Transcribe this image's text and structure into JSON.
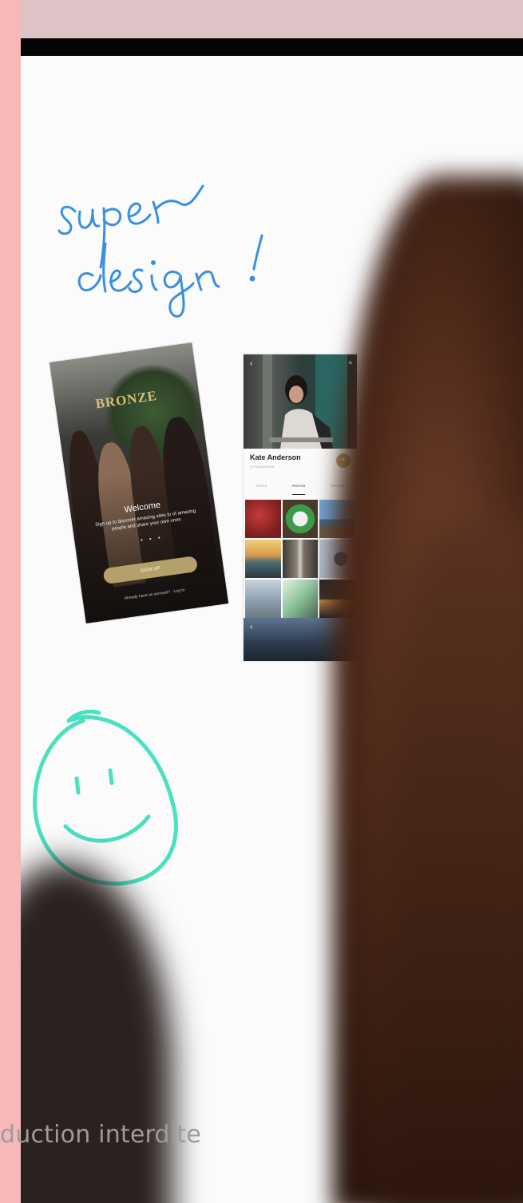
{
  "handwriting": {
    "line1": "super",
    "line2": "design!"
  },
  "phone_login": {
    "brand": "BRONZE",
    "welcome": "Welcome",
    "subtitle": "Sign up to discover amazing sites to of amazing people and share your own ones",
    "signup_button": "SIGN UP",
    "login_note": "Already have an account? · Log In"
  },
  "phone_profile": {
    "name": "Kate Anderson",
    "subtitle": "CITY/LOCATION",
    "tabs": [
      "POSTS",
      "PHOTOS",
      "FRIENDS"
    ],
    "active_tab": "PHOTOS",
    "add_button": "+"
  },
  "watermark": "duction interdite",
  "colors": {
    "handwriting": "#3a8fe0",
    "smiley": "#4ae0c0",
    "accent_gold": "#b3a06a"
  }
}
